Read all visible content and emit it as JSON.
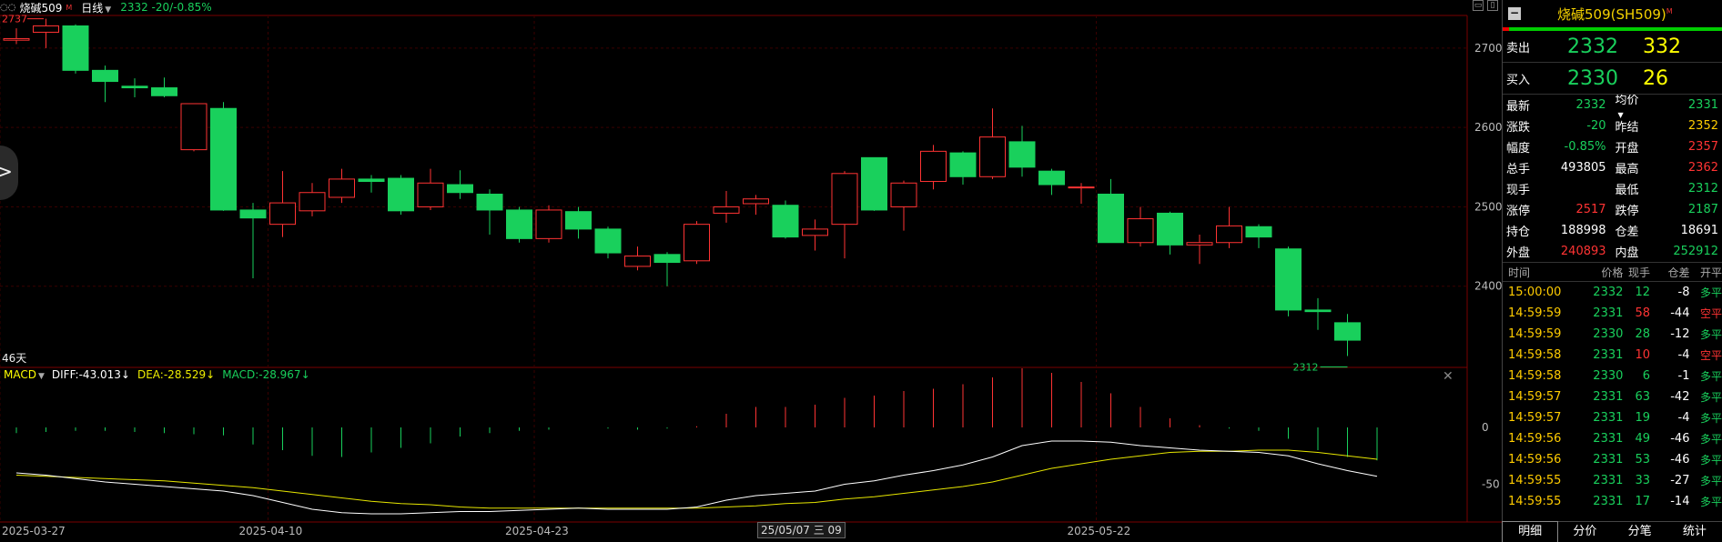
{
  "topbar": {
    "symbol": "烧碱509",
    "symbol_mark": "M",
    "period": "日线",
    "price_change": "2332 -20/-0.85%"
  },
  "chart_data": {
    "type": "candlestick",
    "y_ticks": [
      "2700",
      "2600",
      "2500",
      "2400"
    ],
    "ylim": [
      2300,
      2740
    ],
    "x_tick_labels": [
      "2025-03-27",
      "2025-04-10",
      "2025-04-23",
      "2025-05-22"
    ],
    "max_label": "2737",
    "min_label": "2312",
    "days_label": "46天",
    "bars": [
      {
        "o": 2710,
        "h": 2725,
        "l": 2705,
        "c": 2712
      },
      {
        "o": 2720,
        "h": 2737,
        "l": 2700,
        "c": 2728
      },
      {
        "o": 2728,
        "h": 2730,
        "l": 2668,
        "c": 2672
      },
      {
        "o": 2672,
        "h": 2678,
        "l": 2632,
        "c": 2658
      },
      {
        "o": 2652,
        "h": 2662,
        "l": 2638,
        "c": 2650
      },
      {
        "o": 2650,
        "h": 2663,
        "l": 2638,
        "c": 2640
      },
      {
        "o": 2572,
        "h": 2620,
        "l": 2570,
        "c": 2630
      },
      {
        "o": 2624,
        "h": 2632,
        "l": 2495,
        "c": 2496
      },
      {
        "o": 2496,
        "h": 2505,
        "l": 2410,
        "c": 2486
      },
      {
        "o": 2478,
        "h": 2545,
        "l": 2462,
        "c": 2505
      },
      {
        "o": 2495,
        "h": 2530,
        "l": 2488,
        "c": 2518
      },
      {
        "o": 2512,
        "h": 2548,
        "l": 2505,
        "c": 2535
      },
      {
        "o": 2535,
        "h": 2540,
        "l": 2518,
        "c": 2532
      },
      {
        "o": 2536,
        "h": 2540,
        "l": 2490,
        "c": 2495
      },
      {
        "o": 2500,
        "h": 2548,
        "l": 2496,
        "c": 2530
      },
      {
        "o": 2528,
        "h": 2546,
        "l": 2510,
        "c": 2518
      },
      {
        "o": 2516,
        "h": 2522,
        "l": 2465,
        "c": 2496
      },
      {
        "o": 2496,
        "h": 2500,
        "l": 2455,
        "c": 2460
      },
      {
        "o": 2460,
        "h": 2502,
        "l": 2455,
        "c": 2496
      },
      {
        "o": 2494,
        "h": 2500,
        "l": 2460,
        "c": 2472
      },
      {
        "o": 2472,
        "h": 2475,
        "l": 2435,
        "c": 2442
      },
      {
        "o": 2425,
        "h": 2450,
        "l": 2420,
        "c": 2438
      },
      {
        "o": 2440,
        "h": 2443,
        "l": 2400,
        "c": 2430
      },
      {
        "o": 2432,
        "h": 2482,
        "l": 2428,
        "c": 2478
      },
      {
        "o": 2492,
        "h": 2520,
        "l": 2480,
        "c": 2500
      },
      {
        "o": 2504,
        "h": 2515,
        "l": 2490,
        "c": 2510
      },
      {
        "o": 2502,
        "h": 2508,
        "l": 2460,
        "c": 2462
      },
      {
        "o": 2464,
        "h": 2484,
        "l": 2445,
        "c": 2472
      },
      {
        "o": 2478,
        "h": 2545,
        "l": 2435,
        "c": 2542
      },
      {
        "o": 2562,
        "h": 2562,
        "l": 2495,
        "c": 2496
      },
      {
        "o": 2500,
        "h": 2533,
        "l": 2470,
        "c": 2530
      },
      {
        "o": 2532,
        "h": 2578,
        "l": 2522,
        "c": 2570
      },
      {
        "o": 2568,
        "h": 2570,
        "l": 2528,
        "c": 2538
      },
      {
        "o": 2538,
        "h": 2624,
        "l": 2535,
        "c": 2588
      },
      {
        "o": 2582,
        "h": 2602,
        "l": 2538,
        "c": 2550
      },
      {
        "o": 2545,
        "h": 2548,
        "l": 2515,
        "c": 2528
      },
      {
        "o": 2525,
        "h": 2530,
        "l": 2504,
        "c": 2525
      },
      {
        "o": 2516,
        "h": 2535,
        "l": 2455,
        "c": 2455
      },
      {
        "o": 2455,
        "h": 2500,
        "l": 2450,
        "c": 2485
      },
      {
        "o": 2492,
        "h": 2494,
        "l": 2440,
        "c": 2452
      },
      {
        "o": 2452,
        "h": 2465,
        "l": 2428,
        "c": 2455
      },
      {
        "o": 2455,
        "h": 2500,
        "l": 2448,
        "c": 2476
      },
      {
        "o": 2475,
        "h": 2478,
        "l": 2448,
        "c": 2462
      },
      {
        "o": 2447,
        "h": 2450,
        "l": 2362,
        "c": 2370
      },
      {
        "o": 2370,
        "h": 2385,
        "l": 2345,
        "c": 2368
      },
      {
        "o": 2354,
        "h": 2365,
        "l": 2312,
        "c": 2332
      }
    ],
    "macd_indicator": {
      "name": "MACD",
      "diff_label": "DIFF:-43.013↓",
      "dea_label": "DEA:-28.529↓",
      "macd_label": "MACD:-28.967↓",
      "y_ticks": [
        "0",
        "-50"
      ],
      "ylim": [
        -80,
        40
      ],
      "diff": [
        -40,
        -42,
        -45,
        -48,
        -50,
        -52,
        -54,
        -56,
        -60,
        -66,
        -72,
        -75,
        -76,
        -76,
        -75,
        -74,
        -74,
        -73,
        -72,
        -71,
        -72,
        -72,
        -72,
        -70,
        -64,
        -60,
        -58,
        -56,
        -50,
        -47,
        -42,
        -38,
        -33,
        -26,
        -16,
        -12,
        -12,
        -13,
        -16,
        -18,
        -20,
        -21,
        -22,
        -25,
        -32,
        -38,
        -43
      ],
      "dea": [
        -42,
        -43,
        -44,
        -45,
        -46,
        -47,
        -49,
        -51,
        -53,
        -56,
        -59,
        -62,
        -65,
        -67,
        -68,
        -70,
        -71,
        -71,
        -71,
        -71,
        -71,
        -71,
        -71,
        -71,
        -70,
        -69,
        -67,
        -66,
        -63,
        -61,
        -58,
        -55,
        -52,
        -48,
        -42,
        -36,
        -32,
        -28,
        -25,
        -22,
        -21,
        -21,
        -20,
        -20,
        -22,
        -25,
        -28
      ],
      "macd": [
        -5,
        -4,
        -3,
        -3,
        -4,
        -5,
        -6,
        -7,
        -15,
        -20,
        -25,
        -26,
        -22,
        -18,
        -14,
        -8,
        -5,
        -3,
        -2,
        0,
        -1,
        -2,
        -1,
        1,
        12,
        18,
        18,
        20,
        26,
        28,
        32,
        34,
        38,
        44,
        52,
        48,
        40,
        30,
        18,
        8,
        2,
        -1,
        -3,
        -10,
        -20,
        -26,
        -29
      ]
    }
  },
  "chart_overlay": {
    "date_tooltip": "25/05/07 三",
    "tooltip_suffix": "09"
  },
  "right_panel": {
    "title": "烧碱509(SH509)",
    "title_mark": "M",
    "sell": {
      "label": "卖出",
      "price": "2332",
      "volume": "332"
    },
    "buy": {
      "label": "买入",
      "price": "2330",
      "volume": "26"
    },
    "stats": [
      {
        "k": "最新",
        "v": "2332",
        "vc": "g",
        "k2": "均价",
        "k2_caret": "▼",
        "v2": "2331",
        "v2c": "g"
      },
      {
        "k": "涨跌",
        "v": "-20",
        "vc": "g",
        "k2": "昨结",
        "v2": "2352",
        "v2c": "y"
      },
      {
        "k": "幅度",
        "v": "-0.85%",
        "vc": "g",
        "k2": "开盘",
        "v2": "2357",
        "v2c": "r"
      },
      {
        "k": "总手",
        "v": "493805",
        "vc": "w",
        "k2": "最高",
        "v2": "2362",
        "v2c": "r"
      },
      {
        "k": "现手",
        "v": "",
        "vc": "w",
        "k2": "最低",
        "v2": "2312",
        "v2c": "g"
      },
      {
        "k": "涨停",
        "v": "2517",
        "vc": "r",
        "k2": "跌停",
        "v2": "2187",
        "v2c": "g"
      },
      {
        "k": "持仓",
        "v": "188998",
        "vc": "w",
        "k2": "仓差",
        "v2": "18691",
        "v2c": "w"
      },
      {
        "k": "外盘",
        "v": "240893",
        "vc": "r",
        "k2": "内盘",
        "v2": "252912",
        "v2c": "g"
      }
    ],
    "trade_headers": [
      "时间",
      "价格",
      "现手",
      "仓差",
      "开平"
    ],
    "trades": [
      {
        "time": "15:00:00",
        "price": "2332",
        "pc": "g",
        "vol": "12",
        "vc": "g",
        "diff": "-8",
        "type": "多平",
        "tc": "g"
      },
      {
        "time": "14:59:59",
        "price": "2331",
        "pc": "g",
        "vol": "58",
        "vc": "r",
        "diff": "-44",
        "type": "空平",
        "tc": "r"
      },
      {
        "time": "14:59:59",
        "price": "2330",
        "pc": "g",
        "vol": "28",
        "vc": "g",
        "diff": "-12",
        "type": "多平",
        "tc": "g"
      },
      {
        "time": "14:59:58",
        "price": "2331",
        "pc": "g",
        "vol": "10",
        "vc": "r",
        "diff": "-4",
        "type": "空平",
        "tc": "r"
      },
      {
        "time": "14:59:58",
        "price": "2330",
        "pc": "g",
        "vol": "6",
        "vc": "g",
        "diff": "-1",
        "type": "多平",
        "tc": "g"
      },
      {
        "time": "14:59:57",
        "price": "2331",
        "pc": "g",
        "vol": "63",
        "vc": "g",
        "diff": "-42",
        "type": "多平",
        "tc": "g"
      },
      {
        "time": "14:59:57",
        "price": "2331",
        "pc": "g",
        "vol": "19",
        "vc": "g",
        "diff": "-4",
        "type": "多平",
        "tc": "g"
      },
      {
        "time": "14:59:56",
        "price": "2331",
        "pc": "g",
        "vol": "49",
        "vc": "g",
        "diff": "-46",
        "type": "多平",
        "tc": "g"
      },
      {
        "time": "14:59:56",
        "price": "2331",
        "pc": "g",
        "vol": "53",
        "vc": "g",
        "diff": "-46",
        "type": "多平",
        "tc": "g"
      },
      {
        "time": "14:59:55",
        "price": "2331",
        "pc": "g",
        "vol": "33",
        "vc": "g",
        "diff": "-27",
        "type": "多平",
        "tc": "g"
      },
      {
        "time": "14:59:55",
        "price": "2331",
        "pc": "g",
        "vol": "17",
        "vc": "g",
        "diff": "-14",
        "type": "多平",
        "tc": "g"
      }
    ],
    "tabs": [
      "明细",
      "分价",
      "分笔",
      "统计"
    ]
  },
  "colors": {
    "up": "#ff3333",
    "down": "#19d05c",
    "dif_line": "#ffffff",
    "dea_line": "#e6e600",
    "grid": "#3a0000"
  }
}
